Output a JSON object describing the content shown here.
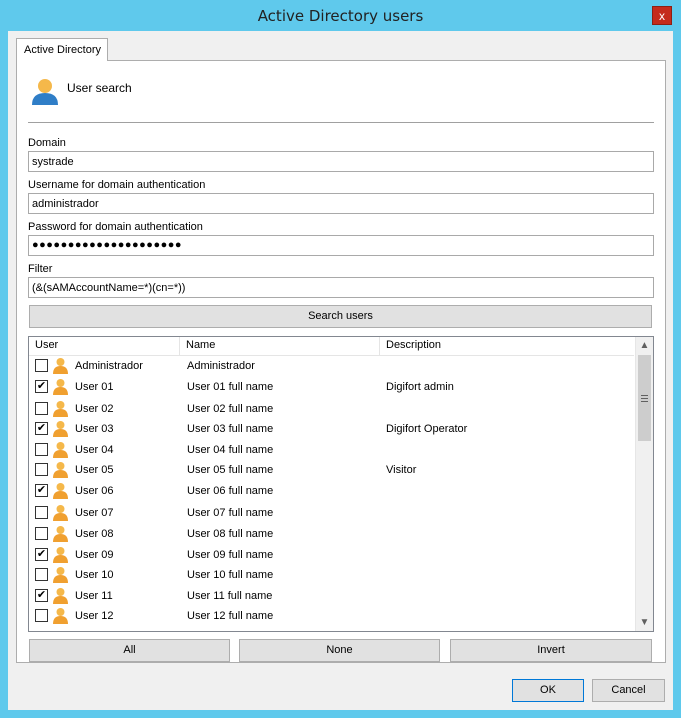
{
  "window": {
    "title": "Active Directory users",
    "close_label": "x"
  },
  "tab": {
    "label": "Active Directory"
  },
  "header": {
    "label": "User search"
  },
  "form": {
    "domain_label": "Domain",
    "domain_value": "systrade",
    "username_label": "Username for domain authentication",
    "username_value": "administrador",
    "password_label": "Password for domain authentication",
    "password_mask": "●●●●●●●●●●●●●●●●●●●●●",
    "filter_label": "Filter",
    "filter_value": "(&(sAMAccountName=*)(cn=*))"
  },
  "search_button": "Search users",
  "list": {
    "columns": [
      "User",
      "Name",
      "Description"
    ],
    "rows": [
      {
        "checked": false,
        "user": "Administrador",
        "name": "Administrador",
        "description": ""
      },
      {
        "checked": true,
        "user": "User 01",
        "name": "User 01 full name",
        "description": "Digifort admin"
      },
      {
        "checked": false,
        "user": "User 02",
        "name": "User 02 full name",
        "description": ""
      },
      {
        "checked": true,
        "user": "User 03",
        "name": "User 03 full name",
        "description": "Digifort Operator"
      },
      {
        "checked": false,
        "user": "User 04",
        "name": "User 04 full name",
        "description": ""
      },
      {
        "checked": false,
        "user": "User 05",
        "name": "User 05 full name",
        "description": "Visitor"
      },
      {
        "checked": true,
        "user": "User 06",
        "name": "User 06 full name",
        "description": ""
      },
      {
        "checked": false,
        "user": "User 07",
        "name": "User 07 full name",
        "description": ""
      },
      {
        "checked": false,
        "user": "User 08",
        "name": "User 08 full name",
        "description": ""
      },
      {
        "checked": true,
        "user": "User 09",
        "name": "User 09 full name",
        "description": ""
      },
      {
        "checked": false,
        "user": "User 10",
        "name": "User 10 full name",
        "description": ""
      },
      {
        "checked": true,
        "user": "User 11",
        "name": "User 11 full name",
        "description": ""
      },
      {
        "checked": false,
        "user": "User 12",
        "name": "User 12 full name",
        "description": ""
      }
    ]
  },
  "selection_buttons": {
    "all": "All",
    "none": "None",
    "invert": "Invert"
  },
  "footer": {
    "ok": "OK",
    "cancel": "Cancel"
  },
  "icons": {
    "user": "user-icon",
    "close": "close-icon",
    "scroll_up": "chevron-up-icon",
    "scroll_down": "chevron-down-icon"
  },
  "colors": {
    "titlebar": "#5fc9ec",
    "close": "#c42b1c",
    "user_body": "#f0a030",
    "user_head": "#f5b84a"
  }
}
